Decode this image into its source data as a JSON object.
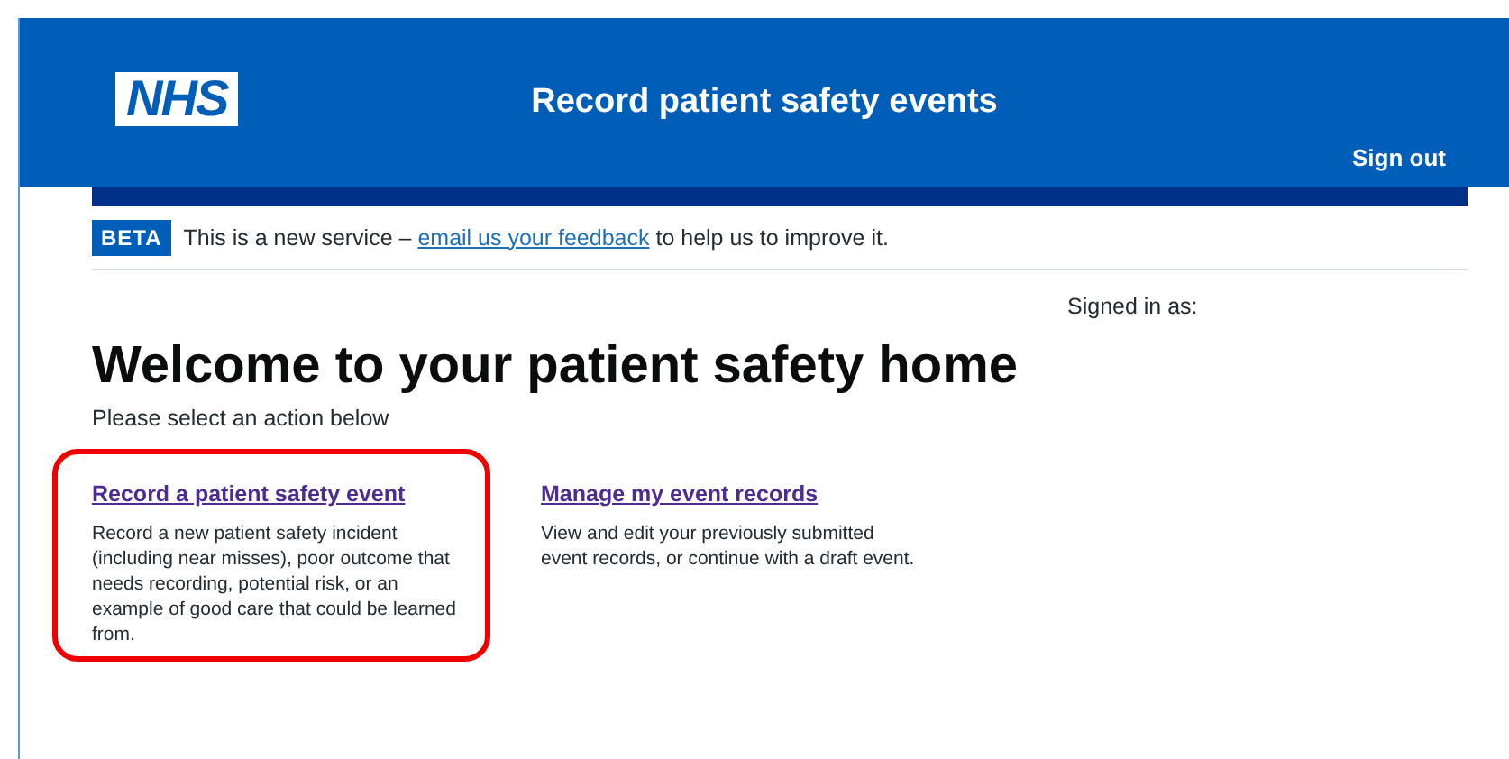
{
  "header": {
    "logo": "NHS",
    "title": "Record patient safety events",
    "sign_out": "Sign out"
  },
  "beta_banner": {
    "tag": "BETA",
    "before": "This is a new service –",
    "link": "email us your feedback",
    "after": "to help us to improve it."
  },
  "signed_in": "Signed in as:",
  "heading": "Welcome to your patient safety home",
  "subheading": "Please select an action below",
  "actions": [
    {
      "title": "Record a patient safety event",
      "description": "Record a new patient safety incident (including near misses), poor outcome that needs recording, potential risk, or an example of good care that could be learned from.",
      "highlighted": true
    },
    {
      "title": "Manage my event records",
      "description": "View and edit your previously submitted event records, or continue with a draft event.",
      "highlighted": false
    }
  ]
}
